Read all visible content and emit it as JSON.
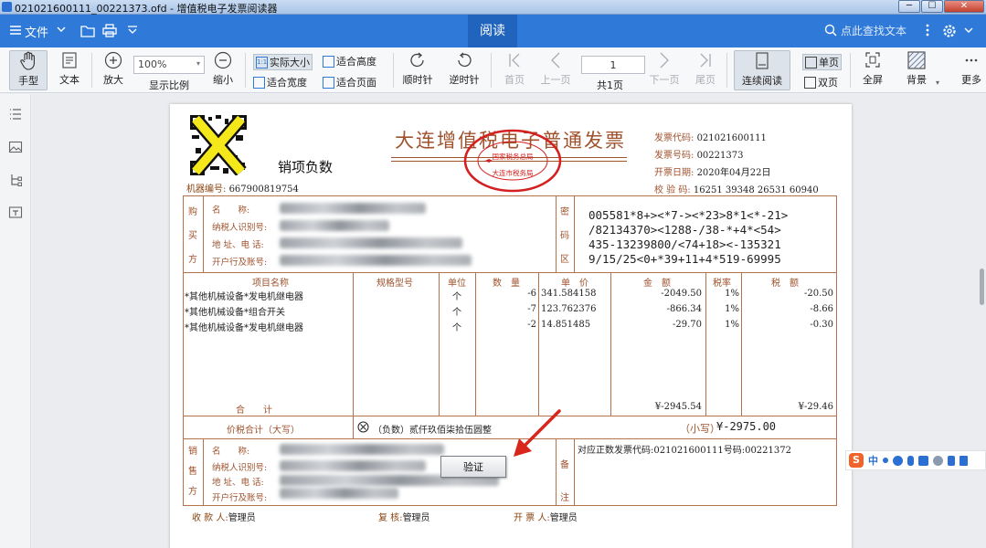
{
  "window": {
    "title": "021021600111_00221373.ofd - 增值税电子发票阅读器",
    "min": "─",
    "max": "☐",
    "close": "✕"
  },
  "menubar": {
    "file": "文件",
    "read_tab": "阅读",
    "search_placeholder": "点此查找文本"
  },
  "toolbar": {
    "hand": "手型",
    "text": "文本",
    "zoom_in": "放大",
    "zoom_value": "100%",
    "display_ratio": "显示比例",
    "zoom_out": "缩小",
    "actual_size": "实际大小",
    "fit_height": "适合高度",
    "fit_width": "适合宽度",
    "fit_page": "适合页面",
    "clockwise": "顺时针",
    "counterclockwise": "逆时针",
    "first_page": "首页",
    "prev_page": "上一页",
    "page_num": "1",
    "total_pages": "共1页",
    "next_page": "下一页",
    "last_page": "尾页",
    "continuous": "连续阅读",
    "single_page": "单页",
    "double_page": "双页",
    "fullscreen": "全屏",
    "background": "背景",
    "more": "更多"
  },
  "invoice": {
    "negative_label": "销项负数",
    "title": "大连增值税电子普通发票",
    "seal_lines": [
      "国家税务总局",
      "大连市税务局"
    ],
    "invoice_code_k": "发票代码:",
    "invoice_code": "021021600111",
    "invoice_no_k": "发票号码:",
    "invoice_no": "00221373",
    "issue_date_k": "开票日期:",
    "issue_date": "2020年04月22日",
    "check_code_k": "校 验 码:",
    "check_code": "16251 39348 26531 60940",
    "machine_no_k": "机器编号:",
    "machine_no": "667900819754",
    "buyer_label": [
      "购",
      "买",
      "方"
    ],
    "name_k": "名　　称:",
    "tax_id_k": "纳税人识别号:",
    "addr_k": "地 址、电 话:",
    "bank_k": "开户行及账号:",
    "cipher_label": [
      "密",
      "码",
      "区"
    ],
    "cipher": "005581*8+><*7-><*23>8*1<*-21>\n/82134370><1288-/38-*+4*<54>\n435-13239800/<74+18><-135321\n9/15/25<0+*39+11+4*519-69995",
    "col_name": "项目名称",
    "col_spec": "规格型号",
    "col_unit": "单位",
    "col_qty": "数　量",
    "col_price": "单　价",
    "col_amount": "金　额",
    "col_rate": "税率",
    "col_tax": "税　额",
    "items": [
      {
        "name": "*其他机械设备*发电机继电器",
        "unit": "个",
        "qty": "-6",
        "price": "341.584158",
        "amount": "-2049.50",
        "rate": "1%",
        "tax": "-20.50"
      },
      {
        "name": "*其他机械设备*组合开关",
        "unit": "个",
        "qty": "-7",
        "price": "123.762376",
        "amount": "-866.34",
        "rate": "1%",
        "tax": "-8.66"
      },
      {
        "name": "*其他机械设备*发电机继电器",
        "unit": "个",
        "qty": "-2",
        "price": "14.851485",
        "amount": "-29.70",
        "rate": "1%",
        "tax": "-0.30"
      }
    ],
    "total_label": "合　　计",
    "total_amount": "¥-2945.54",
    "total_tax": "¥-29.46",
    "grand_label": "价税合计（大写）",
    "grand_upper": "（负数）贰仟玖佰柒拾伍圆整",
    "grand_lower_k": "（小写）",
    "grand_lower": "¥-2975.00",
    "seller_label": [
      "销",
      "售",
      "方"
    ],
    "remark_label": [
      "备",
      "注"
    ],
    "remark": "对应正数发票代码:021021600111号码:00221372",
    "verify_button": "验证",
    "payee_k": "收 款 人:",
    "payee": "管理员",
    "reviewer_k": "复 核:",
    "reviewer": "管理员",
    "drawer_k": "开 票 人:",
    "drawer": "管理员"
  },
  "ime": {
    "mode": "中"
  },
  "colors": {
    "menubar": "#2f7ad8",
    "invoice_brown": "#a0522d",
    "seal_red": "#d42020",
    "arrow_red": "#d9261c"
  }
}
